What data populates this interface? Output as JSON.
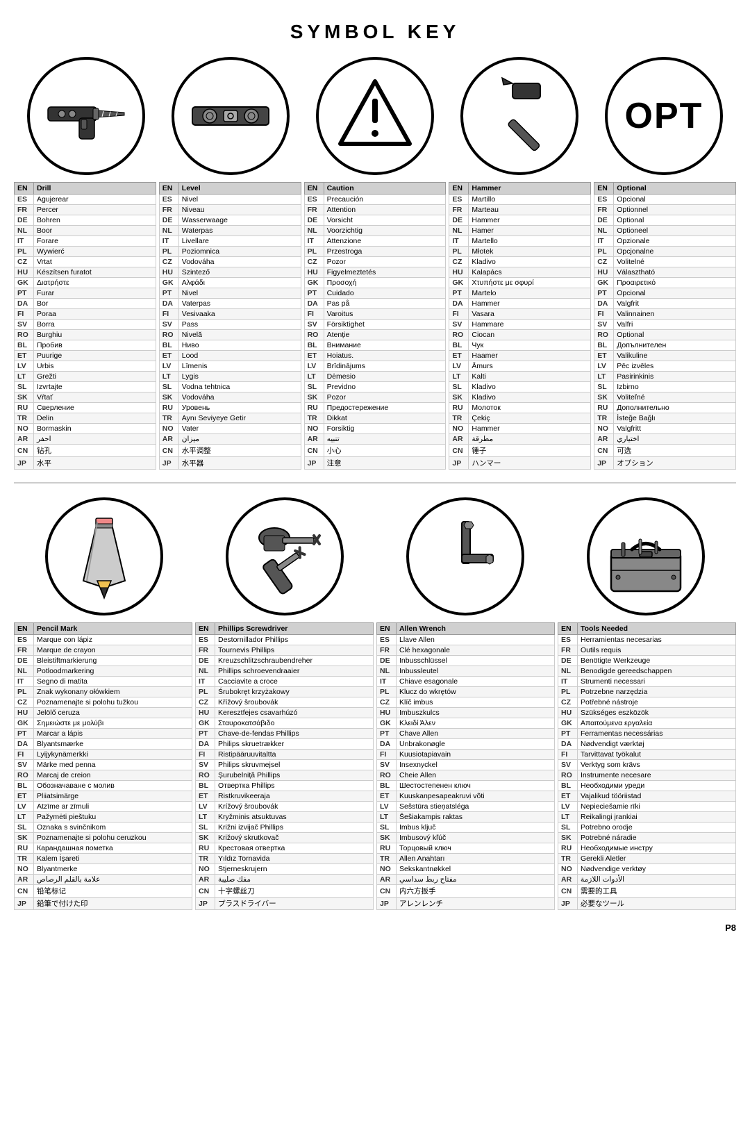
{
  "page": {
    "title": "SYMBOL KEY",
    "page_num": "P8"
  },
  "symbols_row1": [
    {
      "id": "drill",
      "name": "Drill Symbol"
    },
    {
      "id": "level",
      "name": "Level Symbol"
    },
    {
      "id": "caution",
      "name": "Caution Symbol"
    },
    {
      "id": "hammer",
      "name": "Hammer Symbol"
    },
    {
      "id": "optional",
      "name": "Optional Symbol"
    }
  ],
  "tables_row1": [
    {
      "header_lang": "EN",
      "header_word": "Drill",
      "rows": [
        [
          "ES",
          "Agujerear"
        ],
        [
          "FR",
          "Percer"
        ],
        [
          "DE",
          "Bohren"
        ],
        [
          "NL",
          "Boor"
        ],
        [
          "IT",
          "Forare"
        ],
        [
          "PL",
          "Wywierć"
        ],
        [
          "CZ",
          "Vrtat"
        ],
        [
          "HU",
          "Készítsen furatot"
        ],
        [
          "GK",
          "Διατρήστε"
        ],
        [
          "PT",
          "Furar"
        ],
        [
          "DA",
          "Bor"
        ],
        [
          "FI",
          "Poraa"
        ],
        [
          "SV",
          "Borra"
        ],
        [
          "RO",
          "Burghiu"
        ],
        [
          "BL",
          "Пробив"
        ],
        [
          "ET",
          "Puurige"
        ],
        [
          "LV",
          "Urbis"
        ],
        [
          "LT",
          "Grežti"
        ],
        [
          "SL",
          "Izvrtajte"
        ],
        [
          "SK",
          "Vŕtať"
        ],
        [
          "RU",
          "Сверление"
        ],
        [
          "TR",
          "Delin"
        ],
        [
          "NO",
          "Bormaskin"
        ],
        [
          "AR",
          "احفر"
        ],
        [
          "CN",
          "钻孔"
        ],
        [
          "JP",
          "水平"
        ]
      ]
    },
    {
      "header_lang": "EN",
      "header_word": "Level",
      "rows": [
        [
          "ES",
          "Nivel"
        ],
        [
          "FR",
          "Niveau"
        ],
        [
          "DE",
          "Wasserwaage"
        ],
        [
          "NL",
          "Waterpas"
        ],
        [
          "IT",
          "Livellare"
        ],
        [
          "PL",
          "Poziomnica"
        ],
        [
          "CZ",
          "Vodováha"
        ],
        [
          "HU",
          "Szintező"
        ],
        [
          "GK",
          "Αλφάδι"
        ],
        [
          "PT",
          "Nivel"
        ],
        [
          "DA",
          "Vaterpas"
        ],
        [
          "FI",
          "Vesivaaka"
        ],
        [
          "SV",
          "Pass"
        ],
        [
          "RO",
          "Nivelă"
        ],
        [
          "BL",
          "Ниво"
        ],
        [
          "ET",
          "Lood"
        ],
        [
          "LV",
          "Līmenis"
        ],
        [
          "LT",
          "Lygis"
        ],
        [
          "SL",
          "Vodna tehtnica"
        ],
        [
          "SK",
          "Vodováha"
        ],
        [
          "RU",
          "Уровень"
        ],
        [
          "TR",
          "Aynı Seviyeye Getir"
        ],
        [
          "NO",
          "Vater"
        ],
        [
          "AR",
          "ميزان"
        ],
        [
          "CN",
          "水平调整"
        ],
        [
          "JP",
          "水平器"
        ]
      ]
    },
    {
      "header_lang": "EN",
      "header_word": "Caution",
      "rows": [
        [
          "ES",
          "Precaución"
        ],
        [
          "FR",
          "Attention"
        ],
        [
          "DE",
          "Vorsicht"
        ],
        [
          "NL",
          "Voorzichtig"
        ],
        [
          "IT",
          "Attenzione"
        ],
        [
          "PL",
          "Przestroga"
        ],
        [
          "CZ",
          "Pozor"
        ],
        [
          "HU",
          "Figyelmeztetés"
        ],
        [
          "GK",
          "Προσοχή"
        ],
        [
          "PT",
          "Cuidado"
        ],
        [
          "DA",
          "Pas på"
        ],
        [
          "FI",
          "Varoitus"
        ],
        [
          "SV",
          "Försiktighet"
        ],
        [
          "RO",
          "Atenție"
        ],
        [
          "BL",
          "Внимание"
        ],
        [
          "ET",
          "Hoiatus."
        ],
        [
          "LV",
          "Brīdinājums"
        ],
        [
          "LT",
          "Dėmesio"
        ],
        [
          "SL",
          "Previdno"
        ],
        [
          "SK",
          "Pozor"
        ],
        [
          "RU",
          "Предостережение"
        ],
        [
          "TR",
          "Dikkat"
        ],
        [
          "NO",
          "Forsiktig"
        ],
        [
          "AR",
          "تنبيه"
        ],
        [
          "CN",
          "小心"
        ],
        [
          "JP",
          "注意"
        ]
      ]
    },
    {
      "header_lang": "EN",
      "header_word": "Hammer",
      "rows": [
        [
          "ES",
          "Martillo"
        ],
        [
          "FR",
          "Marteau"
        ],
        [
          "DE",
          "Hammer"
        ],
        [
          "NL",
          "Hamer"
        ],
        [
          "IT",
          "Martello"
        ],
        [
          "PL",
          "Młotek"
        ],
        [
          "CZ",
          "Kladivo"
        ],
        [
          "HU",
          "Kalapács"
        ],
        [
          "GK",
          "Χτυπήστε με σφυρί"
        ],
        [
          "PT",
          "Martelo"
        ],
        [
          "DA",
          "Hammer"
        ],
        [
          "FI",
          "Vasara"
        ],
        [
          "SV",
          "Hammare"
        ],
        [
          "RO",
          "Ciocan"
        ],
        [
          "BL",
          "Чук"
        ],
        [
          "ET",
          "Haamer"
        ],
        [
          "LV",
          "Āmurs"
        ],
        [
          "LT",
          "Kalti"
        ],
        [
          "SL",
          "Kladivo"
        ],
        [
          "SK",
          "Kladivo"
        ],
        [
          "RU",
          "Молоток"
        ],
        [
          "TR",
          "Çekiç"
        ],
        [
          "NO",
          "Hammer"
        ],
        [
          "AR",
          "مطرقة"
        ],
        [
          "CN",
          "锤子"
        ],
        [
          "JP",
          "ハンマー"
        ]
      ]
    },
    {
      "header_lang": "EN",
      "header_word": "Optional",
      "rows": [
        [
          "ES",
          "Opcional"
        ],
        [
          "FR",
          "Optionnel"
        ],
        [
          "DE",
          "Optional"
        ],
        [
          "NL",
          "Optioneel"
        ],
        [
          "IT",
          "Opzionale"
        ],
        [
          "PL",
          "Opcjonalne"
        ],
        [
          "CZ",
          "Volitelné"
        ],
        [
          "HU",
          "Választható"
        ],
        [
          "GK",
          "Προαιρετικό"
        ],
        [
          "PT",
          "Opcional"
        ],
        [
          "DA",
          "Valgfrit"
        ],
        [
          "FI",
          "Valinnainen"
        ],
        [
          "SV",
          "Valfri"
        ],
        [
          "RO",
          "Optional"
        ],
        [
          "BL",
          "Допълнителен"
        ],
        [
          "ET",
          "Valikuline"
        ],
        [
          "LV",
          "Pēc izvēles"
        ],
        [
          "LT",
          "Pasirinkinis"
        ],
        [
          "SL",
          "Izbirno"
        ],
        [
          "SK",
          "Voliteľné"
        ],
        [
          "RU",
          "Дополнительно"
        ],
        [
          "TR",
          "İsteğe Bağlı"
        ],
        [
          "NO",
          "Valgfritt"
        ],
        [
          "AR",
          "اختياري"
        ],
        [
          "CN",
          "可选"
        ],
        [
          "JP",
          "オプション"
        ]
      ]
    }
  ],
  "tables_row2": [
    {
      "header_lang": "EN",
      "header_word": "Pencil Mark",
      "rows": [
        [
          "ES",
          "Marque con lápiz"
        ],
        [
          "FR",
          "Marque de crayon"
        ],
        [
          "DE",
          "Bleistiftmarkierung"
        ],
        [
          "NL",
          "Potloodmarkering"
        ],
        [
          "IT",
          "Segno di matita"
        ],
        [
          "PL",
          "Znak wykonany ołówkiem"
        ],
        [
          "CZ",
          "Poznamenajte si polohu tužkou"
        ],
        [
          "HU",
          "Jelölő ceruza"
        ],
        [
          "GK",
          "Σημειώστε με μολύβι"
        ],
        [
          "PT",
          "Marcar a lápis"
        ],
        [
          "DA",
          "Blyantsmærke"
        ],
        [
          "FI",
          "Lyijykynämerkki"
        ],
        [
          "SV",
          "Märke med penna"
        ],
        [
          "RO",
          "Marcaj de creion"
        ],
        [
          "BL",
          "Обозначаване с молив"
        ],
        [
          "ET",
          "Pliiatsimärge"
        ],
        [
          "LV",
          "Atzīme ar zīmuli"
        ],
        [
          "LT",
          "Pažymėti pieštuku"
        ],
        [
          "SL",
          "Oznaka s svinčnikom"
        ],
        [
          "SK",
          "Poznamenajte si polohu ceruzkou"
        ],
        [
          "RU",
          "Карандашная пометка"
        ],
        [
          "TR",
          "Kalem İşareti"
        ],
        [
          "NO",
          "Blyantmerke"
        ],
        [
          "AR",
          "علامة بالقلم الرصاص"
        ],
        [
          "CN",
          "铅笔标记"
        ],
        [
          "JP",
          "鉛筆で付けた印"
        ]
      ]
    },
    {
      "header_lang": "EN",
      "header_word": "Phillips Screwdriver",
      "rows": [
        [
          "ES",
          "Destornillador Phillips"
        ],
        [
          "FR",
          "Tournevis Phillips"
        ],
        [
          "DE",
          "Kreuzschlitzschraubendreher"
        ],
        [
          "NL",
          "Phillips schroevendraaier"
        ],
        [
          "IT",
          "Cacciavite a croce"
        ],
        [
          "PL",
          "Śrubokręt krzyżakowy"
        ],
        [
          "CZ",
          "Křížový šroubovák"
        ],
        [
          "HU",
          "Keresztfejes csavarhúzó"
        ],
        [
          "GK",
          "Σταυροκατσάβιδο"
        ],
        [
          "PT",
          "Chave-de-fendas Phillips"
        ],
        [
          "DA",
          "Philips skruetrækker"
        ],
        [
          "FI",
          "Ristipääruuvitaltta"
        ],
        [
          "SV",
          "Philips skruvmejsel"
        ],
        [
          "RO",
          "Șurubelniță Phillips"
        ],
        [
          "BL",
          "Отвертка Phillips"
        ],
        [
          "ET",
          "Ristkruvikeeraja"
        ],
        [
          "LV",
          "Krížový šroubovák"
        ],
        [
          "LT",
          "Kryžminis atsuktuvas"
        ],
        [
          "SL",
          "Križni izvijač Phillips"
        ],
        [
          "SK",
          "Križový skrutkovač"
        ],
        [
          "RU",
          "Крестовая отвертка"
        ],
        [
          "TR",
          "Yıldız Tornavida"
        ],
        [
          "NO",
          "Stjerneskrujern"
        ],
        [
          "AR",
          "مفك صليبة"
        ],
        [
          "CN",
          "十字螺丝刀"
        ],
        [
          "JP",
          "プラスドライバー"
        ]
      ]
    },
    {
      "header_lang": "EN",
      "header_word": "Allen Wrench",
      "rows": [
        [
          "ES",
          "Llave Allen"
        ],
        [
          "FR",
          "Clé hexagonale"
        ],
        [
          "DE",
          "Inbusschlüssel"
        ],
        [
          "NL",
          "Inbussleutel"
        ],
        [
          "IT",
          "Chiave esagonale"
        ],
        [
          "PL",
          "Klucz do wkrętów"
        ],
        [
          "CZ",
          "Klíč imbus"
        ],
        [
          "HU",
          "Imbuszkulcs"
        ],
        [
          "GK",
          "Κλειδί Άλεν"
        ],
        [
          "PT",
          "Chave Allen"
        ],
        [
          "DA",
          "Unbrakonøgle"
        ],
        [
          "FI",
          "Kuusiotapiavain"
        ],
        [
          "SV",
          "Insexnyckel"
        ],
        [
          "RO",
          "Cheie Allen"
        ],
        [
          "BL",
          "Шестостепенен ключ"
        ],
        [
          "ET",
          "Kuuskanpesapeakruvi võti"
        ],
        [
          "LV",
          "Sešstūra stieņatsléga"
        ],
        [
          "LT",
          "Šešiakampis raktas"
        ],
        [
          "SL",
          "Imbus ključ"
        ],
        [
          "SK",
          "Imbusový kľúč"
        ],
        [
          "RU",
          "Торцовый ключ"
        ],
        [
          "TR",
          "Allen Anahtarı"
        ],
        [
          "NO",
          "Sekskantnøkkel"
        ],
        [
          "AR",
          "مفتاح ربط سداسي"
        ],
        [
          "CN",
          "内六方扳手"
        ],
        [
          "JP",
          "アレンレンチ"
        ]
      ]
    },
    {
      "header_lang": "EN",
      "header_word": "Tools Needed",
      "rows": [
        [
          "ES",
          "Herramientas necesarias"
        ],
        [
          "FR",
          "Outils requis"
        ],
        [
          "DE",
          "Benötigte Werkzeuge"
        ],
        [
          "NL",
          "Benodigde gereedschappen"
        ],
        [
          "IT",
          "Strumenti necessari"
        ],
        [
          "PL",
          "Potrzebne narzędzia"
        ],
        [
          "CZ",
          "Potřebné nástroje"
        ],
        [
          "HU",
          "Szükséges eszközök"
        ],
        [
          "GK",
          "Απαιτούμενα εργαλεία"
        ],
        [
          "PT",
          "Ferramentas necessárias"
        ],
        [
          "DA",
          "Nødvendigt værktøj"
        ],
        [
          "FI",
          "Tarvittavat työkalut"
        ],
        [
          "SV",
          "Verktyg som krävs"
        ],
        [
          "RO",
          "Instrumente necesare"
        ],
        [
          "BL",
          "Необходими уреди"
        ],
        [
          "ET",
          "Vajalikud tööriistad"
        ],
        [
          "LV",
          "Nepieciešamie rīki"
        ],
        [
          "LT",
          "Reikalingi įrankiai"
        ],
        [
          "SL",
          "Potrebno orodje"
        ],
        [
          "SK",
          "Potrebné náradie"
        ],
        [
          "RU",
          "Необходимые инстру"
        ],
        [
          "TR",
          "Gerekli Aletler"
        ],
        [
          "NO",
          "Nødvendige verktøy"
        ],
        [
          "AR",
          "الأدوات اللازمة"
        ],
        [
          "CN",
          "需要的工具"
        ],
        [
          "JP",
          "必要なツール"
        ]
      ]
    }
  ]
}
